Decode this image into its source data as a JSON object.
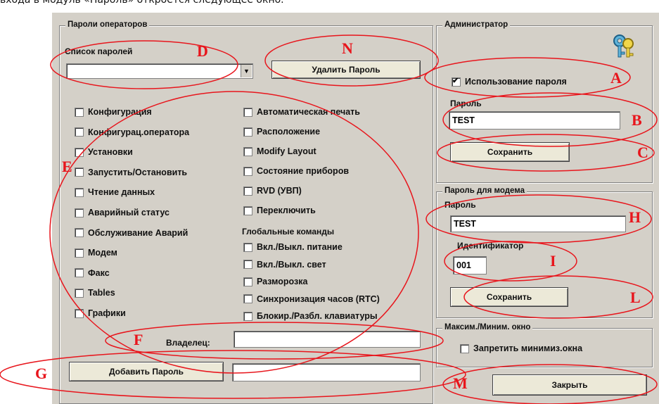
{
  "caption": "входа в модуль «Пароль» откроется следующее окно.",
  "operators": {
    "group_title": "Пароли операторов",
    "list_label": "Список паролей",
    "list_value": "",
    "delete_button": "Удалить Пароль",
    "left_checks": [
      {
        "label": "Конфигурация",
        "checked": false
      },
      {
        "label": "Конфигурац.оператора",
        "checked": false
      },
      {
        "label": "Установки",
        "checked": false
      },
      {
        "label": "Запустить/Остановить",
        "checked": false
      },
      {
        "label": "Чтение данных",
        "checked": false
      },
      {
        "label": "Аварийный статус",
        "checked": false
      },
      {
        "label": "Обслуживание Аварий",
        "checked": false
      },
      {
        "label": "Модем",
        "checked": false
      },
      {
        "label": "Факс",
        "checked": false
      },
      {
        "label": "Tables",
        "checked": false
      },
      {
        "label": "Графики",
        "checked": false
      }
    ],
    "right_checks": [
      {
        "label": "Автоматическая печать",
        "checked": false
      },
      {
        "label": "Расположение",
        "checked": false
      },
      {
        "label": "Modify Layout",
        "checked": false
      },
      {
        "label": "Состояние приборов",
        "checked": false
      },
      {
        "label": "RVD (УВП)",
        "checked": false
      },
      {
        "label": "Переключить",
        "checked": false
      }
    ],
    "global_label": "Глобальные команды",
    "global_checks": [
      {
        "label": "Вкл./Выкл. питание",
        "checked": false
      },
      {
        "label": "Вкл./Выкл. свет",
        "checked": false
      },
      {
        "label": "Разморозка",
        "checked": false
      },
      {
        "label": "Синхронизация часов (RTC)",
        "checked": false
      },
      {
        "label": "Блокир./Разбл. клавиатуры",
        "checked": false
      }
    ],
    "owner_label": "Владелец:",
    "owner_value": "",
    "add_button": "Добавить Пароль",
    "add_value": ""
  },
  "admin": {
    "group_title": "Администратор",
    "icon": "keys-icon",
    "use_password_label": "Использование пароля",
    "use_password_checked": true,
    "password_label": "Пароль",
    "password_value": "TEST",
    "save_button": "Сохранить"
  },
  "modem": {
    "group_title": "Пароль для модема",
    "password_label": "Пароль",
    "password_value": "TEST",
    "id_label": "Идентификатор",
    "id_value": "001",
    "save_button": "Сохранить"
  },
  "minmax": {
    "group_title": "Максим./Миним. окно",
    "disable_min_label": "Запретить минимиз.окна",
    "disable_min_checked": false
  },
  "close_button": "Закрыть",
  "annotations": {
    "A": "A",
    "B": "B",
    "C": "C",
    "D": "D",
    "E": "E",
    "F": "F",
    "G": "G",
    "H": "H",
    "I": "I",
    "L": "L",
    "M": "M",
    "N": "N",
    "color": "#e8151c"
  }
}
